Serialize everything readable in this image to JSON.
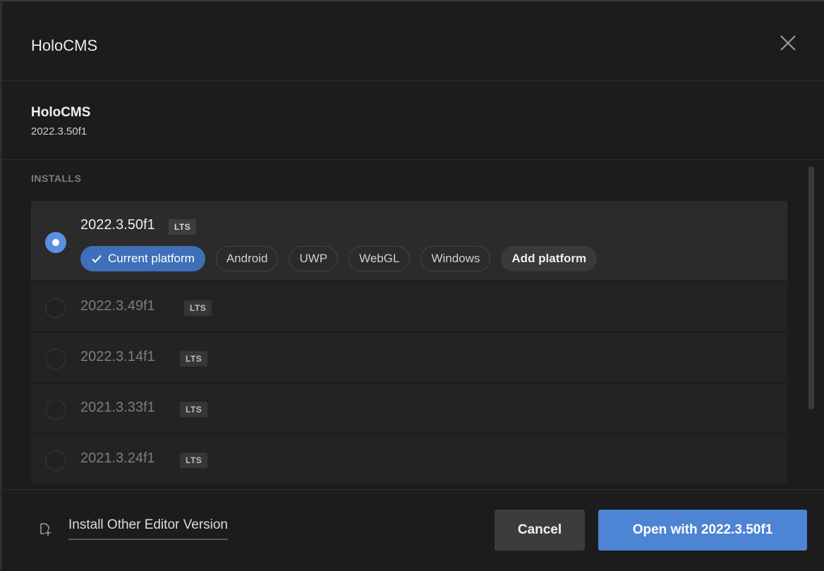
{
  "dialog": {
    "title": "HoloCMS"
  },
  "project": {
    "name": "HoloCMS",
    "version": "2022.3.50f1"
  },
  "installs": {
    "heading": "INSTALLS",
    "items": [
      {
        "version": "2022.3.50f1",
        "badge": "LTS",
        "selected": true,
        "platforms": [
          "Current platform",
          "Android",
          "UWP",
          "WebGL",
          "Windows"
        ],
        "add_platform": "Add platform"
      },
      {
        "version": "2022.3.49f1",
        "badge": "LTS",
        "selected": false
      },
      {
        "version": "2022.3.14f1",
        "badge": "LTS",
        "selected": false
      },
      {
        "version": "2021.3.33f1",
        "badge": "LTS",
        "selected": false
      },
      {
        "version": "2021.3.24f1",
        "badge": "LTS",
        "selected": false
      }
    ]
  },
  "footer": {
    "install_other": "Install Other Editor Version",
    "cancel": "Cancel",
    "open": "Open with 2022.3.50f1"
  },
  "colors": {
    "accent": "#4d84d4",
    "background": "#1c1c1c",
    "selected_row": "#2b2b2b"
  },
  "icons": {
    "close": "close-icon",
    "check": "check-icon",
    "install_other": "add-editor-icon"
  }
}
